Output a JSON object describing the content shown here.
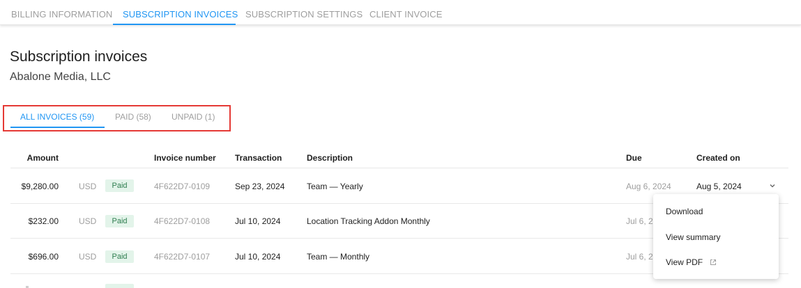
{
  "top_tabs": [
    {
      "label": "BILLING INFORMATION",
      "active": false
    },
    {
      "label": "SUBSCRIPTION INVOICES",
      "active": true
    },
    {
      "label": "SUBSCRIPTION SETTINGS",
      "active": false
    },
    {
      "label": "CLIENT INVOICE",
      "active": false
    }
  ],
  "page": {
    "title": "Subscription invoices",
    "subtitle": "Abalone Media, LLC"
  },
  "filter_tabs": [
    {
      "label": "ALL INVOICES (59)",
      "active": true
    },
    {
      "label": "PAID (58)",
      "active": false
    },
    {
      "label": "UNPAID (1)",
      "active": false
    }
  ],
  "table": {
    "headers": {
      "amount": "Amount",
      "invoice_number": "Invoice number",
      "transaction": "Transaction",
      "description": "Description",
      "due": "Due",
      "created_on": "Created on"
    },
    "rows": [
      {
        "amount": "$9,280.00",
        "currency": "USD",
        "status": "Paid",
        "invoice_number": "4F622D7-0109",
        "transaction": "Sep 23, 2024",
        "description": "Team — Yearly",
        "due": "Aug 6, 2024",
        "created_on": "Aug 5, 2024"
      },
      {
        "amount": "$232.00",
        "currency": "USD",
        "status": "Paid",
        "invoice_number": "4F622D7-0108",
        "transaction": "Jul 10, 2024",
        "description": "Location Tracking Addon Monthly",
        "due": "Jul 6, 2",
        "created_on": ""
      },
      {
        "amount": "$696.00",
        "currency": "USD",
        "status": "Paid",
        "invoice_number": "4F622D7-0107",
        "transaction": "Jul 10, 2024",
        "description": "Team — Monthly",
        "due": "Jul 6, 2",
        "created_on": ""
      }
    ]
  },
  "row_menu": {
    "items": [
      {
        "label": "Download"
      },
      {
        "label": "View summary"
      },
      {
        "label": "View PDF"
      }
    ]
  },
  "colors": {
    "accent": "#2196f3",
    "highlight_box": "#e53935",
    "paid_badge_bg": "#e3f4ea",
    "paid_badge_text": "#2e7d4f"
  },
  "icons": {
    "row_expand": "chevron-down-icon",
    "external_link": "external-link-icon"
  }
}
